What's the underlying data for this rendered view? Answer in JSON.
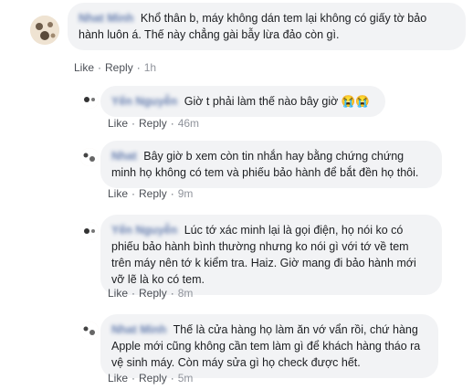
{
  "comments": [
    {
      "author": "Nhat Minh",
      "text": "Khổ thân b, máy không dán tem lại không có giấy tờ bảo hành luôn á. Thế này chẳng gài bẫy lừa đảo còn gì.",
      "like": "Like",
      "reply": "Reply",
      "sep": "·",
      "time": "1h"
    },
    {
      "author": "Yến Nguyễn",
      "text": "Giờ t phải làm thế nào bây giờ 😭😭",
      "like": "Like",
      "reply": "Reply",
      "sep": "·",
      "time": "46m"
    },
    {
      "author": "Nhat",
      "text": "Bây giờ b xem còn tin nhắn hay bằng chứng chứng minh họ không có tem và phiếu bảo hành để bắt đền họ thôi.",
      "like": "Like",
      "reply": "Reply",
      "sep": "·",
      "time": "9m"
    },
    {
      "author": "Yến Nguyễn",
      "text": "Lúc tớ xác minh lại là gọi điện, họ nói ko có phiếu bảo hành bình thường nhưng ko nói gì với tớ về tem trên máy nên tớ k kiểm tra. Haiz. Giờ mang đi bảo hành mới vỡ lẽ là ko có tem.",
      "like": "Like",
      "reply": "Reply",
      "sep": "·",
      "time": "8m"
    },
    {
      "author": "Nhat Minh",
      "text": "Thế là cửa hàng họ làm ăn vớ vẩn rồi, chứ hàng Apple mới cũng không cần tem làm gì để khách hàng tháo ra vệ sinh máy. Còn máy sửa gì họ check được hết.",
      "like": "Like",
      "reply": "Reply",
      "sep": "·",
      "time": "5m"
    }
  ]
}
